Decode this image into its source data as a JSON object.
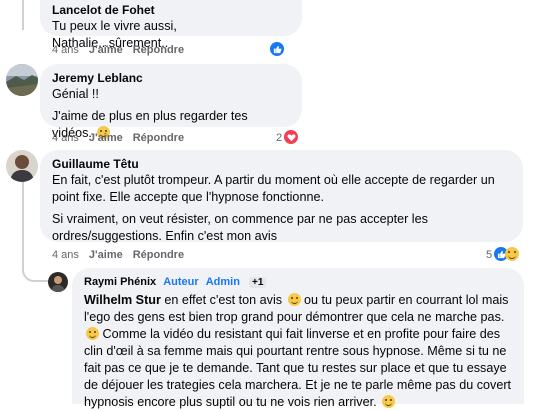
{
  "comments": [
    {
      "author": "Lancelot de Fohet",
      "lines": [
        "Tu peux le vivre aussi, Nathalie...sûrement.."
      ],
      "time": "4 ans",
      "like_label": "J'aime",
      "reply_label": "Répondre",
      "reaction_count": ""
    },
    {
      "author": "Jeremy Leblanc",
      "lines": [
        "Génial !!",
        "J'aime de plus en plus regarder tes vidéos."
      ],
      "time": "4 ans",
      "like_label": "J'aime",
      "reply_label": "Répondre",
      "reaction_count": "2"
    },
    {
      "author": "Guillaume Têtu",
      "lines": [
        "En fait, c'est plutôt trompeur. A partir du moment où elle accepte de regarder un point fixe. Elle accepte que l'hypnose fonctionne.",
        "Si vraiment, on veut résister, on commence par ne pas accepter les ordres/suggestions. Enfin c'est mon avis"
      ],
      "time": "4 ans",
      "like_label": "J'aime",
      "reply_label": "Répondre",
      "reaction_count": "5"
    }
  ],
  "reply": {
    "author": "Raymi Phénix",
    "badge_author": "Auteur",
    "badge_admin": "Admin",
    "badge_count": "+1",
    "mention": "Wilhelm Stur",
    "text": " en effet c'est ton avis ",
    "text2": " ou tu peux partir en courrant lol mais l'ego des gens est bien trop grand pour démontrer que cela ne marche pas. ",
    "text3": " Comme la vidéo du resistant qui fait linverse et en profite pour faire des clin d'œil à sa femme mais qui pourtant rentre sous hypnose. Même si tu ne fait pas ce que je te demande. Tant que tu restes sur place et que tu essaye de déjouer les trategies cela marchera. Et je ne te parle même pas du covert hypnosis encore plus suptil ou tu ne vois rien arriver. "
  }
}
